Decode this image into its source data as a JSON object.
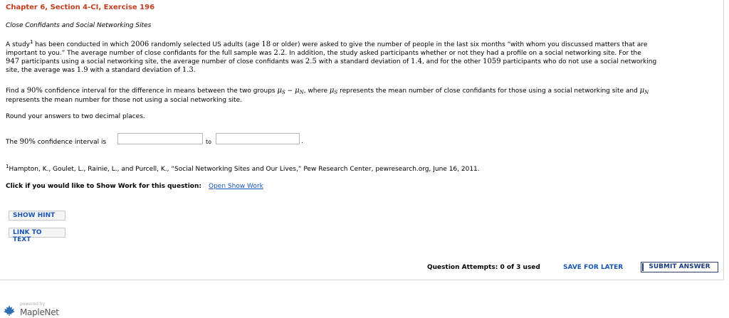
{
  "header": {
    "chapter": "Chapter 6, Section 4-CI, Exercise 196",
    "subtitle": "Close Confidants and Social Networking Sites"
  },
  "problem": {
    "line1": {
      "a": "A study",
      "sup": "1",
      "b": " has been conducted in which ",
      "n_total": "2006",
      "c": " randomly selected US adults (age ",
      "age": "18",
      "d": " or older) were asked to give the number of people in the last six months “with whom you discussed matters that are"
    },
    "line2": {
      "a": "important to you.” The average number of close confidants for the full sample was ",
      "mean_all": "2.2",
      "b": ". In addition, the study asked participants whether or not they had a profile on a social networking site. For the"
    },
    "line3": {
      "n_s": "947",
      "a": " participants using a social networking site, the average number of close confidants was ",
      "mean_s": "2.5",
      "b": " with a standard deviation of ",
      "sd_s": "1.4",
      "c": ", and for the other ",
      "n_n": "1059",
      "d": " participants who do not use a social networking"
    },
    "line4": {
      "a": "site, the average was ",
      "mean_n": "1.9",
      "b": " with a standard deviation of ",
      "sd_n": "1.3",
      "c": "."
    },
    "find1": {
      "a": "Find a ",
      "conf": "90%",
      "b": " confidence interval for the difference in means between the two groups ",
      "mu": "μ",
      "s": "S",
      "minus": " − ",
      "n": "N",
      "c": ", where ",
      "d": " represents the mean number of close confidants for those using a social networking site and "
    },
    "find2": "represents the mean number for those not using a social networking site.",
    "round": "Round your answers to two decimal places."
  },
  "answer": {
    "label_a": "The ",
    "conf": "90%",
    "label_b": " confidence interval is",
    "to": "to",
    "dot": ".",
    "low_value": "",
    "high_value": ""
  },
  "footnote": {
    "sup": "1",
    "text": "Hampton, K., Goulet, L., Rainie, L., and Purcell, K., “Social Networking Sites and Our Lives,” Pew Research Center, pewresearch.org, June 16, 2011."
  },
  "showwork": {
    "label": "Click if you would like to Show Work for this question:",
    "link": "Open Show Work"
  },
  "buttons": {
    "hint": "SHOW HINT",
    "link_to_text": "LINK TO TEXT",
    "save": "SAVE FOR LATER",
    "submit": "SUBMIT ANSWER"
  },
  "attempts": "Question Attempts: 0 of 3 used",
  "branding": {
    "powered": "powered by",
    "name": "MapleNet",
    "leaf_color": "#2e6db0"
  }
}
